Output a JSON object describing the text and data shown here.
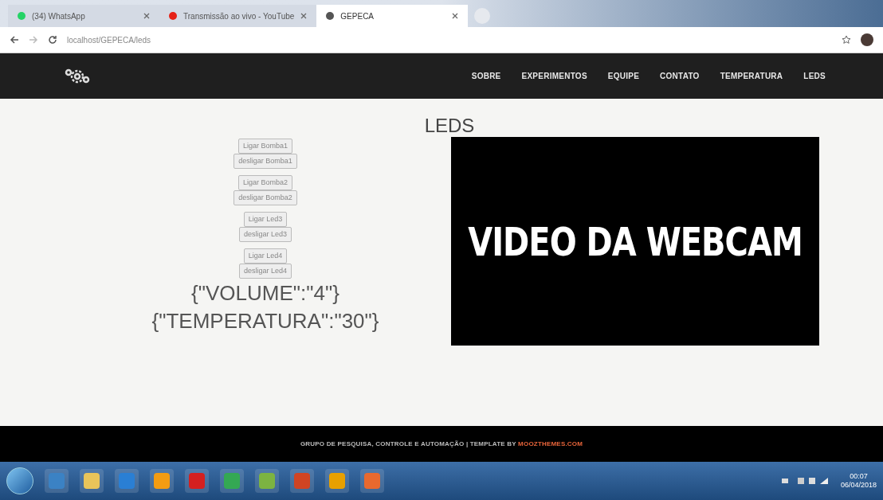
{
  "browser": {
    "tabs": [
      {
        "title": "(34) WhatsApp",
        "selected": false
      },
      {
        "title": "Transmissão ao vivo - YouTube",
        "selected": false
      },
      {
        "title": "GEPECA",
        "selected": true
      }
    ],
    "url": "localhost/GEPECA/leds"
  },
  "nav": {
    "items": [
      {
        "label": "SOBRE"
      },
      {
        "label": "EXPERIMENTOS"
      },
      {
        "label": "EQUIPE"
      },
      {
        "label": "CONTATO"
      },
      {
        "label": "TEMPERATURA"
      },
      {
        "label": "LEDS"
      }
    ]
  },
  "page": {
    "title": "LEDS",
    "button_groups": [
      [
        "Ligar Bomba1",
        "desligar Bomba1"
      ],
      [
        "Ligar Bomba2",
        "desligar Bomba2"
      ],
      [
        "Ligar Led3",
        "desligar Led3"
      ],
      [
        "Ligar Led4",
        "desligar Led4"
      ]
    ],
    "readings": [
      "{\"VOLUME\":\"4\"}",
      "{\"TEMPERATURA\":\"30\"}"
    ],
    "video_text": "VIDEO DA WEBCAM"
  },
  "footer": {
    "text": "GRUPO DE PESQUISA, CONTROLE E AUTOMAÇÃO | TEMPLATE BY ",
    "link": "MOOZTHEMES.COM"
  },
  "taskbar": {
    "time": "00:07",
    "date": "06/04/2018"
  }
}
